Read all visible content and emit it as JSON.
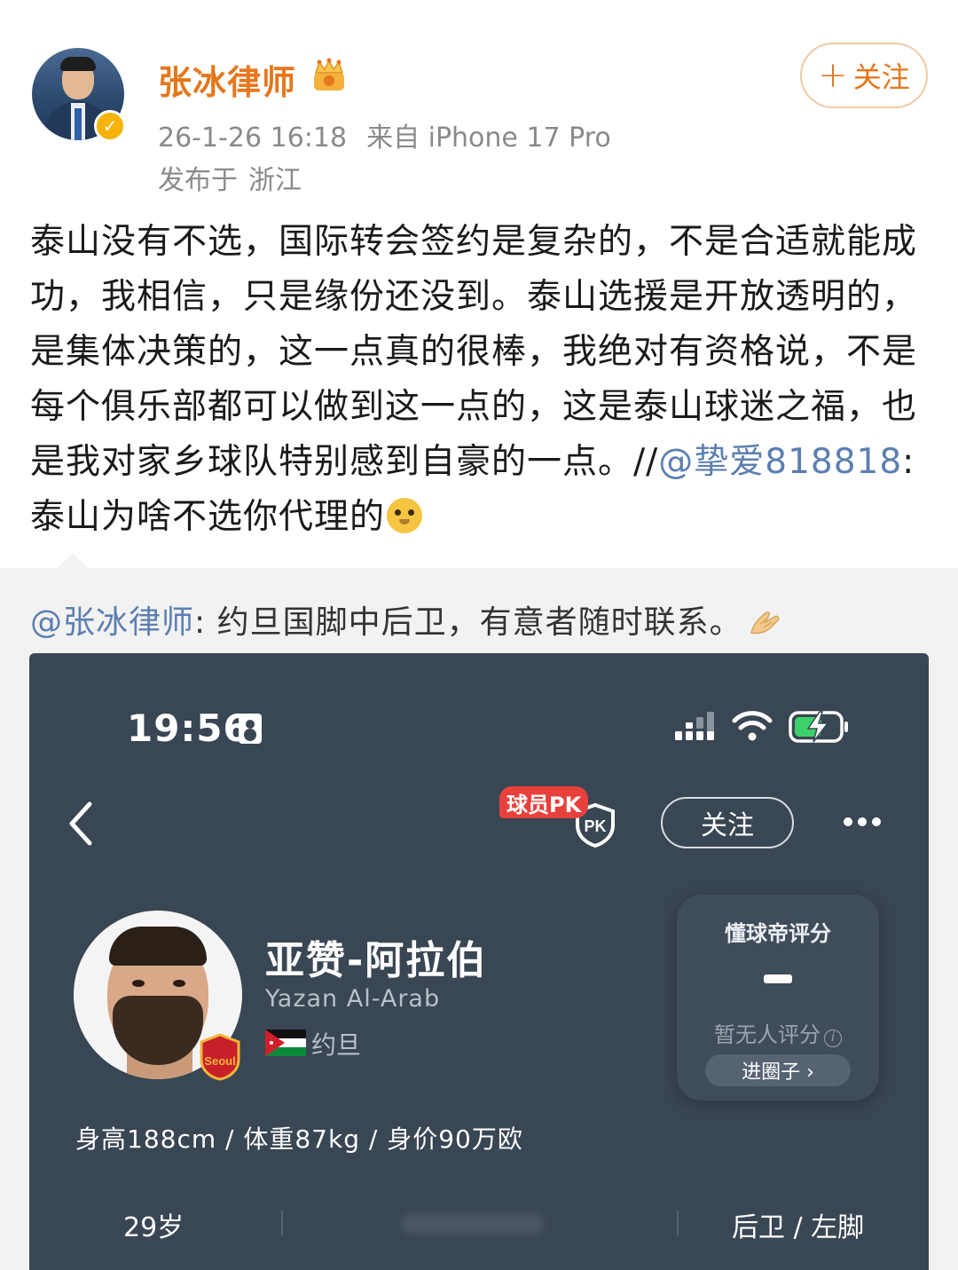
{
  "post": {
    "username": "张冰律师",
    "timestamp": "26-1-26 16:18",
    "source": "来自 iPhone 17 Pro",
    "location_label": "发布于",
    "location": "浙江",
    "follow_button": "关注",
    "follow_plus": "+",
    "text": "泰山没有不选，国际转会签约是复杂的，不是合适就能成功，我相信，只是缘份还没到。泰山选援是开放透明的，是集体决策的，这一点真的很棒，我绝对有资格说，不是每个俱乐部都可以做到这一点的，这是泰山球迷之福，也是我对家乡球队特别感到自豪的一点。//",
    "quoted_mention": "@挚爱818818",
    "quoted_text": ":泰山为啥不选你代理的",
    "icons": [
      "avatar",
      "verified-badge-icon",
      "crown-icon",
      "dog-emoji-icon"
    ],
    "accent_color": "#e5771d"
  },
  "repost": {
    "mention": "@张冰律师",
    "text": ": 约旦国脚中后卫，有意者随时联系。",
    "icons": [
      "praying-hands-icon"
    ],
    "screenshot": {
      "time": "19:56",
      "pk_badge": "球员PK",
      "pk_shield": "PK",
      "follow_button": "关注",
      "player_name": "亚赞-阿拉伯",
      "player_name_en": "Yazan Al-Arab",
      "country": "约旦",
      "rating": {
        "title": "懂球帝评分",
        "no_rating": "暂无人评分",
        "circle_button": "进圈子 ›"
      },
      "stats": {
        "height": "身高188cm",
        "weight": "体重87kg",
        "value": "身价90万欧"
      },
      "age": "29岁",
      "position": "后卫 / 左脚",
      "club_badge_text": "Seoul",
      "background_color": "#394653"
    }
  }
}
